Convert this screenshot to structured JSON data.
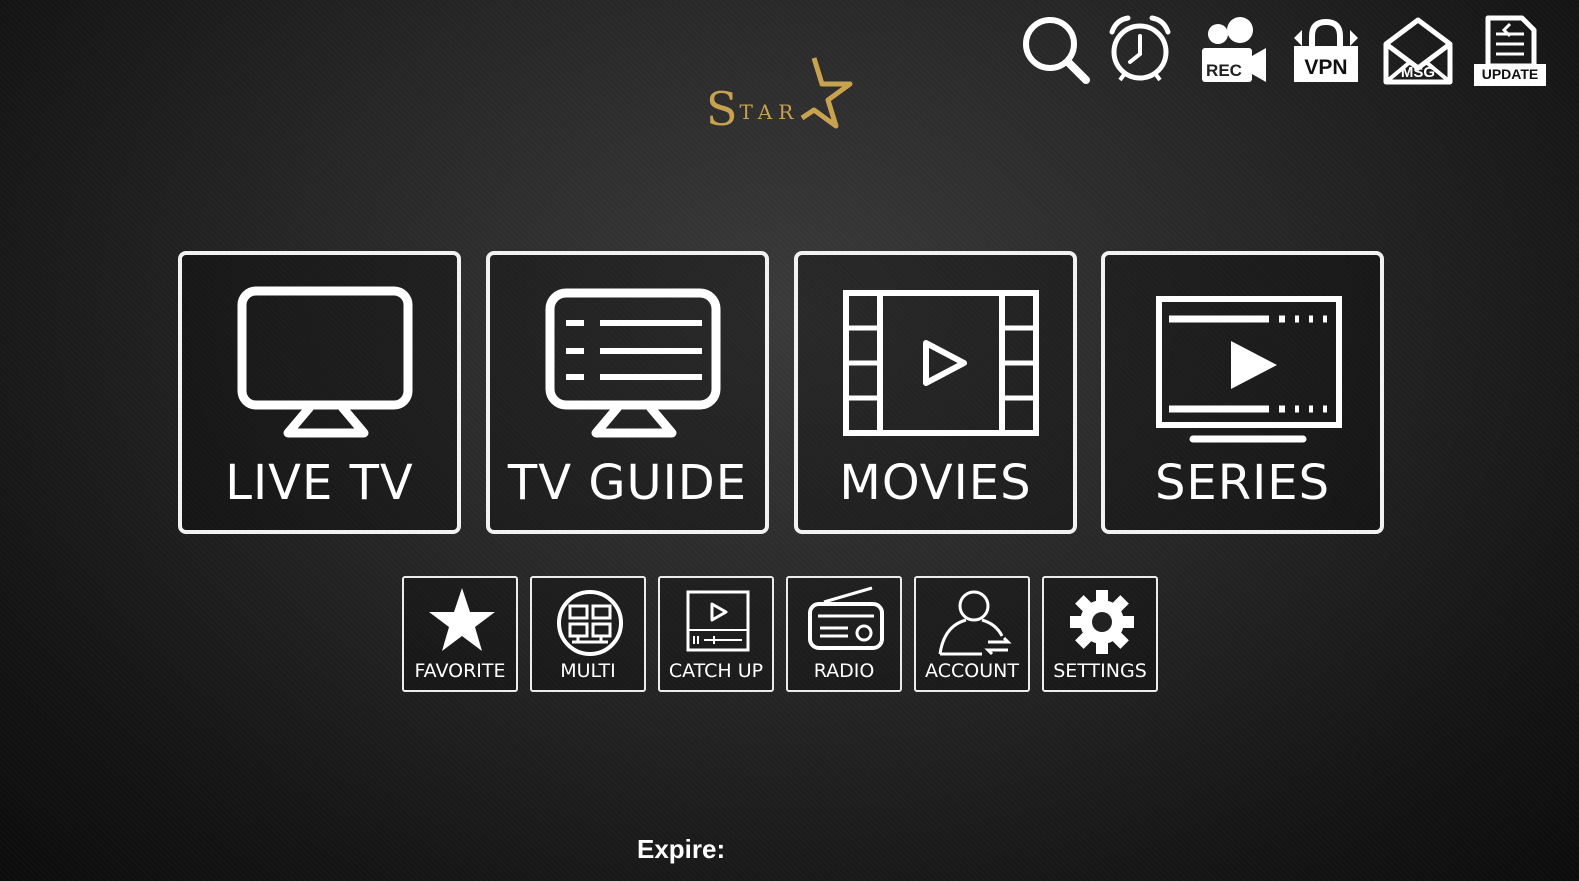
{
  "logo": {
    "initial": "S",
    "rest": "TAR",
    "color": "#c9a250"
  },
  "top_icons": [
    {
      "name": "search-icon",
      "label": ""
    },
    {
      "name": "alarm-clock-icon",
      "label": ""
    },
    {
      "name": "record-camera-icon",
      "label": "REC"
    },
    {
      "name": "vpn-lock-icon",
      "label": "VPN"
    },
    {
      "name": "message-envelope-icon",
      "label": "MSG"
    },
    {
      "name": "update-icon",
      "label": "UPDATE"
    }
  ],
  "main_tiles": [
    {
      "label": "LIVE TV",
      "icon": "tv-icon"
    },
    {
      "label": "TV GUIDE",
      "icon": "tv-guide-icon"
    },
    {
      "label": "MOVIES",
      "icon": "film-play-icon"
    },
    {
      "label": "SERIES",
      "icon": "series-play-icon"
    }
  ],
  "small_tiles": [
    {
      "label": "FAVORITE",
      "icon": "star-icon"
    },
    {
      "label": "MULTI",
      "icon": "multi-screen-icon"
    },
    {
      "label": "CATCH UP",
      "icon": "catch-up-icon"
    },
    {
      "label": "RADIO",
      "icon": "radio-icon"
    },
    {
      "label": "ACCOUNT",
      "icon": "account-icon"
    },
    {
      "label": "SETTINGS",
      "icon": "gear-icon"
    }
  ],
  "footer": {
    "expire_label": "Expire:"
  }
}
